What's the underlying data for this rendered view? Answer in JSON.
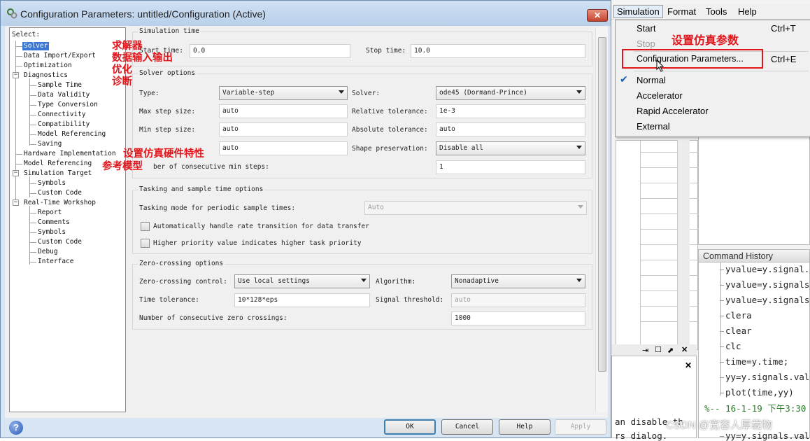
{
  "dialog": {
    "title": "Configuration Parameters: untitled/Configuration (Active)",
    "close_label": "✕"
  },
  "tree": {
    "header": "Select:",
    "items": [
      "Solver",
      "Data Import/Export",
      "Optimization",
      "Diagnostics",
      "Sample Time",
      "Data Validity",
      "Type Conversion",
      "Connectivity",
      "Compatibility",
      "Model Referencing",
      "Saving",
      "Hardware Implementation",
      "Model Referencing",
      "Simulation Target",
      "Symbols",
      "Custom Code",
      "Real-Time Workshop",
      "Report",
      "Comments",
      "Symbols",
      "Custom Code",
      "Debug",
      "Interface"
    ]
  },
  "annotations": {
    "solver": "求解器",
    "data_io": "数据输入输出",
    "optimization": "优化",
    "diagnostics": "诊断",
    "hardware": "设置仿真硬件特性",
    "model_ref": "参考模型",
    "config": "设置仿真参数"
  },
  "simulation_time": {
    "group_title": "Simulation time",
    "start_label": "Start time:",
    "start_value": "0.0",
    "stop_label": "Stop time:",
    "stop_value": "10.0"
  },
  "solver_options": {
    "group_title": "Solver options",
    "type_label": "Type:",
    "type_value": "Variable-step",
    "solver_label": "Solver:",
    "solver_value": "ode45 (Dormand-Prince)",
    "max_step_label": "Max step size:",
    "max_step_value": "auto",
    "rel_tol_label": "Relative tolerance:",
    "rel_tol_value": "1e-3",
    "min_step_label": "Min step size:",
    "min_step_value": "auto",
    "abs_tol_label": "Absolute tolerance:",
    "abs_tol_value": "auto",
    "initial_step_value": "auto",
    "shape_label": "Shape preservation:",
    "shape_value": "Disable all",
    "consecutive_label": "ber of consecutive min steps:",
    "consecutive_value": "1"
  },
  "tasking": {
    "group_title": "Tasking and sample time options",
    "mode_label": "Tasking mode for periodic sample times:",
    "mode_value": "Auto",
    "auto_rate_label": "Automatically handle rate transition for data transfer",
    "priority_label": "Higher priority value indicates higher task priority"
  },
  "zero_crossing": {
    "group_title": "Zero-crossing options",
    "control_label": "Zero-crossing control:",
    "control_value": "Use local settings",
    "algorithm_label": "Algorithm:",
    "algorithm_value": "Nonadaptive",
    "time_tol_label": "Time tolerance:",
    "time_tol_value": "10*128*eps",
    "signal_thr_label": "Signal threshold:",
    "signal_thr_value": "auto",
    "num_zc_label": "Number of consecutive zero crossings:",
    "num_zc_value": "1000"
  },
  "buttons": {
    "ok": "OK",
    "cancel": "Cancel",
    "help": "Help",
    "apply": "Apply"
  },
  "menubar": [
    "Simulation",
    "Format",
    "Tools",
    "Help"
  ],
  "sim_menu": {
    "start": "Start",
    "start_shortcut": "Ctrl+T",
    "stop": "Stop",
    "config": "Configuration Parameters...",
    "config_shortcut": "Ctrl+E",
    "normal": "Normal",
    "accelerator": "Accelerator",
    "rapid": "Rapid Accelerator",
    "external": "External"
  },
  "command_history": {
    "title": "Command History",
    "lines": [
      "yvalue=y.signal.v",
      "yvalue=y.signals.",
      "yvalue=y.signals.",
      "clera",
      "clear",
      "clc",
      "time=y.time;",
      "yy=y.signals.valu",
      "plot(time,yy)"
    ],
    "group": "%-- 16-1-19 下午3:30",
    "bottom_line": "yy=y.signals.valu"
  },
  "command_window": {
    "line1": "an disable th",
    "line2": "rs dialog."
  },
  "watermark": "CSDN @宽容人厚载物",
  "colors": {
    "annotation": "#e0161c",
    "selection": "#3a78d4",
    "title_gradient": "#cfe0f3"
  }
}
